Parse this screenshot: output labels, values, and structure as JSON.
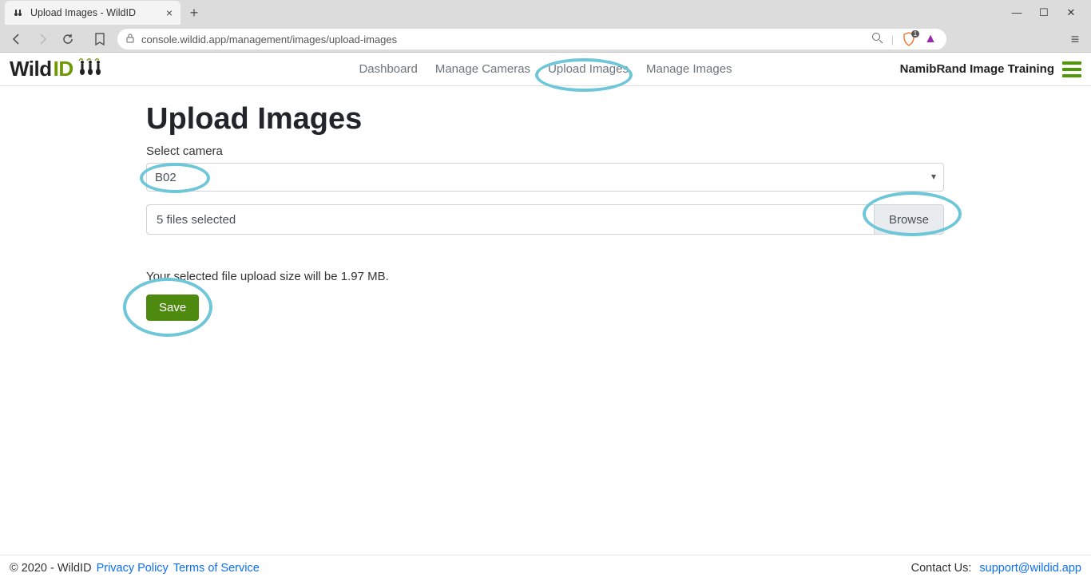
{
  "browser": {
    "tab_title": "Upload Images - WildID",
    "url": "console.wildid.app/management/images/upload-images",
    "shield_count": "1"
  },
  "logo": {
    "part1": "Wild",
    "part2": "ID"
  },
  "nav": {
    "dashboard": "Dashboard",
    "manage_cameras": "Manage Cameras",
    "upload_images": "Upload Images",
    "manage_images": "Manage Images"
  },
  "org_name": "NamibRand Image Training",
  "page": {
    "title": "Upload Images",
    "select_label": "Select camera",
    "camera_value": "B02",
    "files_text": "5 files selected",
    "browse_label": "Browse",
    "upload_info": "Your selected file upload size will be 1.97 MB.",
    "save_label": "Save"
  },
  "footer": {
    "copyright": "© 2020 - WildID",
    "privacy": "Privacy Policy",
    "terms": "Terms of Service",
    "contact_label": "Contact Us: ",
    "contact_email": "support@wildid.app"
  }
}
